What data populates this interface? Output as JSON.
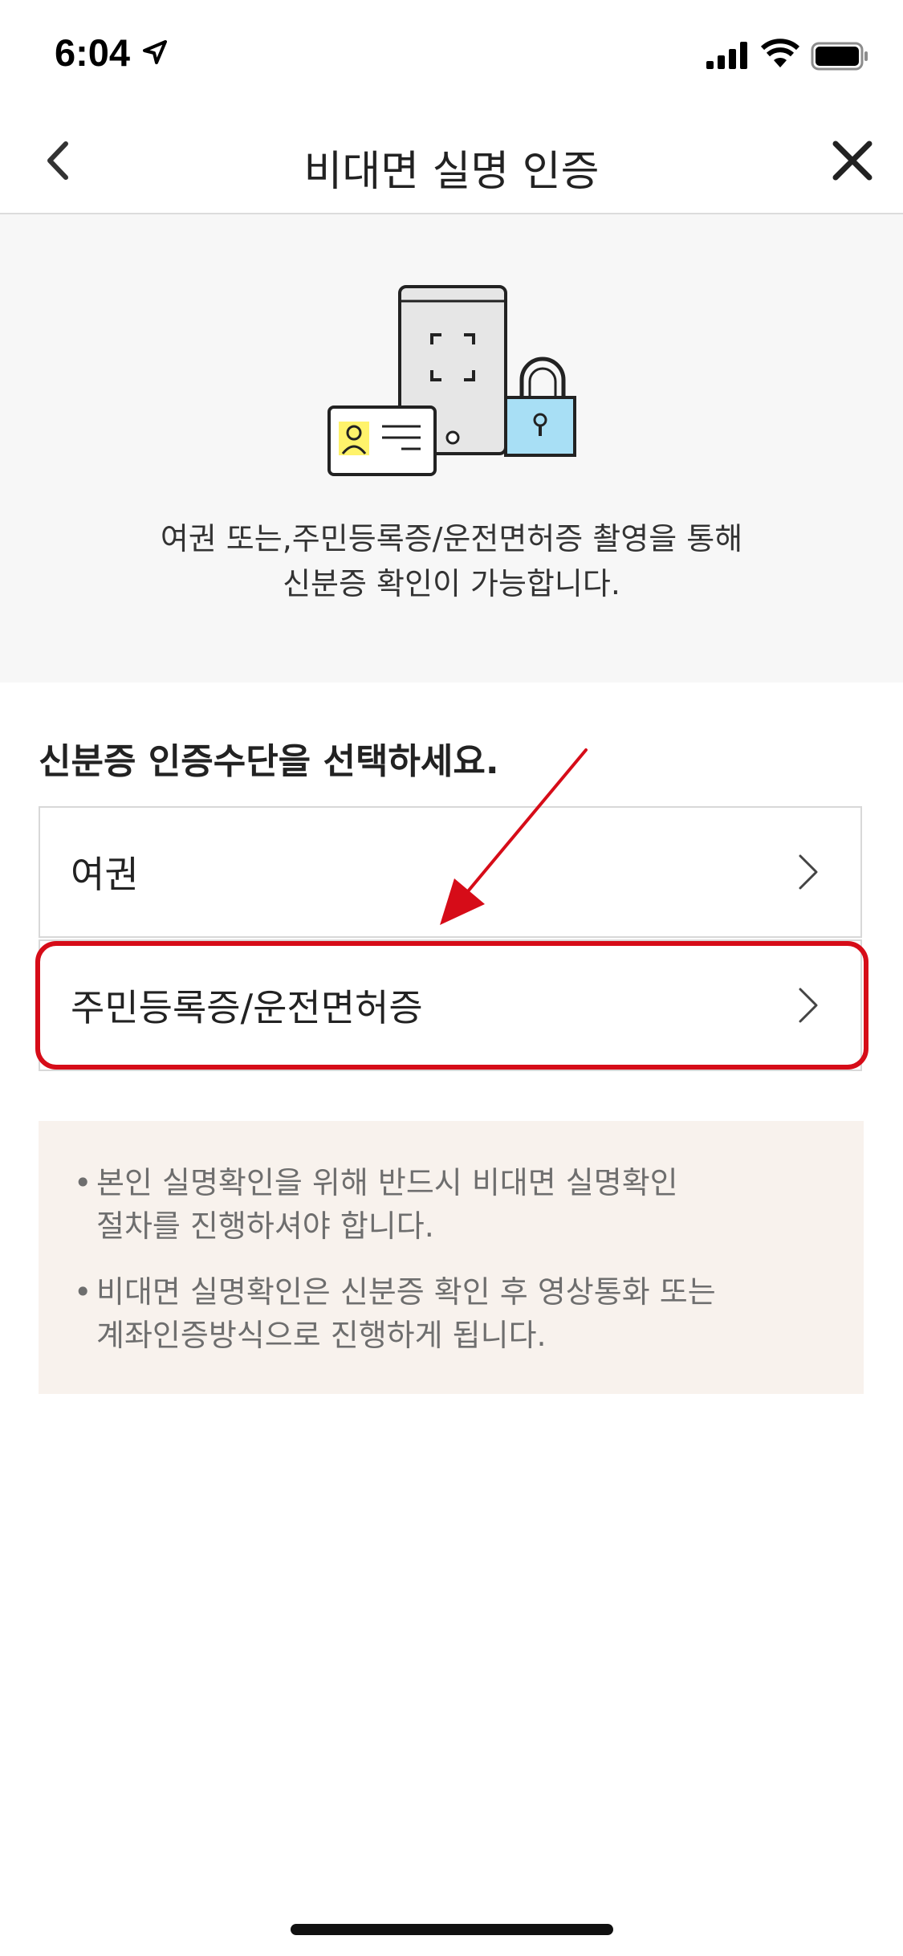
{
  "status_bar": {
    "time": "6:04"
  },
  "nav": {
    "title": "비대면 실명 인증"
  },
  "hero": {
    "desc_line1": "여권 또는,주민등록증/운전면허증 촬영을 통해",
    "desc_line2": "신분증 확인이 가능합니다."
  },
  "section": {
    "title": "신분증 인증수단을 선택하세요."
  },
  "options": [
    {
      "label": "여권"
    },
    {
      "label": "주민등록증/운전면허증"
    }
  ],
  "notices": [
    {
      "line1": "본인 실명확인을 위해 반드시 비대면 실명확인",
      "line2": "절차를 진행하셔야 합니다."
    },
    {
      "line1": "비대면 실명확인은 신분증 확인 후 영상통화 또는",
      "line2": "계좌인증방식으로 진행하게 됩니다."
    }
  ],
  "colors": {
    "highlight": "#d60c18",
    "hero_bg": "#f7f7f7",
    "notice_bg": "#f8f2ed",
    "id_photo": "#fff36b",
    "lock_body": "#a8dff5"
  }
}
